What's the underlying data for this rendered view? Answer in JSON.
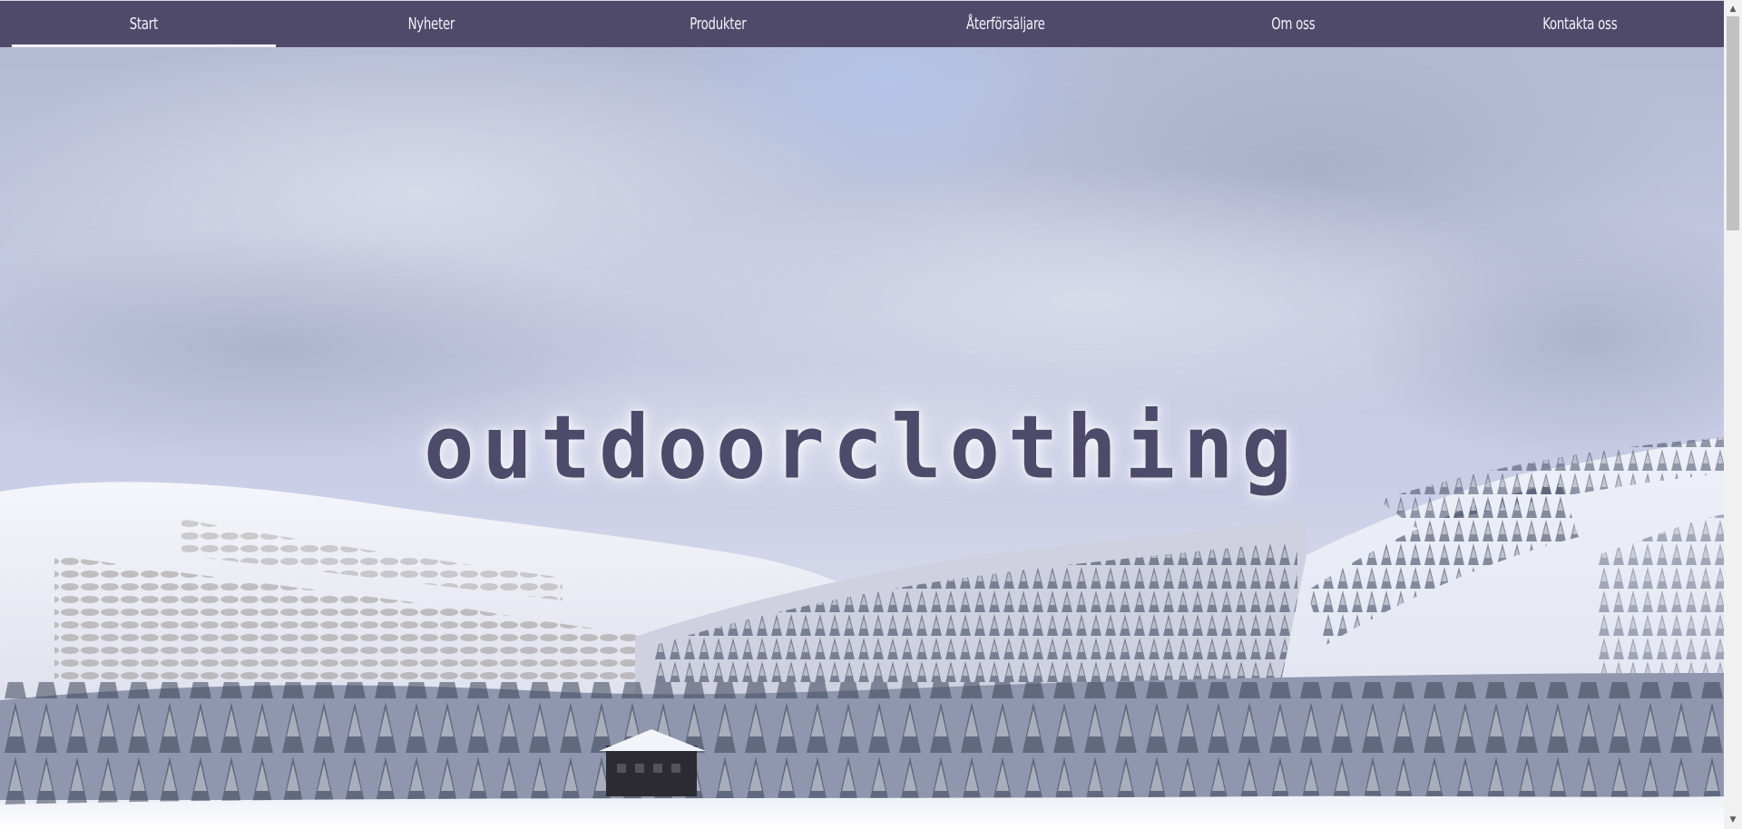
{
  "nav": {
    "items": [
      {
        "label": "Start",
        "active": true
      },
      {
        "label": "Nyheter",
        "active": false
      },
      {
        "label": "Produkter",
        "active": false
      },
      {
        "label": "Återförsäljare",
        "active": false
      },
      {
        "label": "Om oss",
        "active": false
      },
      {
        "label": "Kontakta oss",
        "active": false
      }
    ],
    "background_color": "#4f4a6a",
    "text_color": "#f2f1f7"
  },
  "hero": {
    "title": "outdoorclothing",
    "title_color": "#4e4a69",
    "image": "snowy-mountain-forest-landscape"
  },
  "scrollbar": {
    "up_icon": "chevron-up-icon",
    "down_icon": "chevron-down-icon"
  }
}
